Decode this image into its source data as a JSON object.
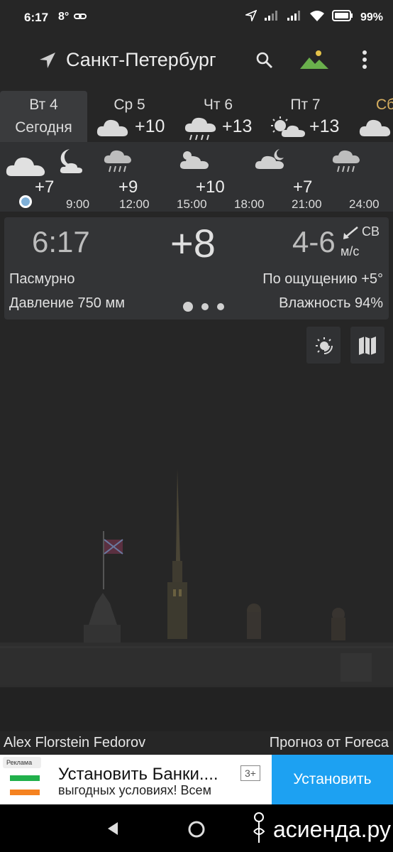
{
  "status_bar": {
    "time": "6:17",
    "temp_indicator": "8°",
    "battery": "99%"
  },
  "header": {
    "city": "Санкт-Петербург"
  },
  "days": [
    {
      "name": "Вт 4",
      "sub": "Сегодня",
      "selected": true
    },
    {
      "name": "Ср 5",
      "temp": "+10",
      "icon": "cloud-icon"
    },
    {
      "name": "Чт 6",
      "temp": "+13",
      "icon": "rain-cloud-icon"
    },
    {
      "name": "Пт 7",
      "temp": "+13",
      "icon": "partly-cloudy-icon"
    },
    {
      "name": "Сб",
      "icon": "cloud-icon"
    }
  ],
  "hourly": {
    "temps": [
      "+7",
      "+9",
      "+10",
      "+7"
    ],
    "times": [
      "9:00",
      "12:00",
      "15:00",
      "18:00",
      "21:00",
      "24:00"
    ]
  },
  "current": {
    "time": "6:17",
    "temp": "+8",
    "wind_speed": "4-6",
    "wind_dir": "СВ",
    "wind_unit": "м/с",
    "condition": "Пасмурно",
    "feels_like": "По ощущению +5°",
    "pressure": "Давление 750 мм",
    "humidity": "Влажность 94%"
  },
  "footer": {
    "photo_credit": "Alex Florstein Fedorov",
    "forecast_source": "Прогноз от Foreca"
  },
  "ad": {
    "badge": "Реклама",
    "title": "Установить Банки....",
    "subtitle": "выгодных условиях! Всем",
    "age": "3+",
    "button": "Установить"
  },
  "watermark": "асиенда.ру",
  "colors": {
    "accent": "#1da1f2",
    "saturday": "#d8b060",
    "now_dot": "#7fb0d8"
  }
}
